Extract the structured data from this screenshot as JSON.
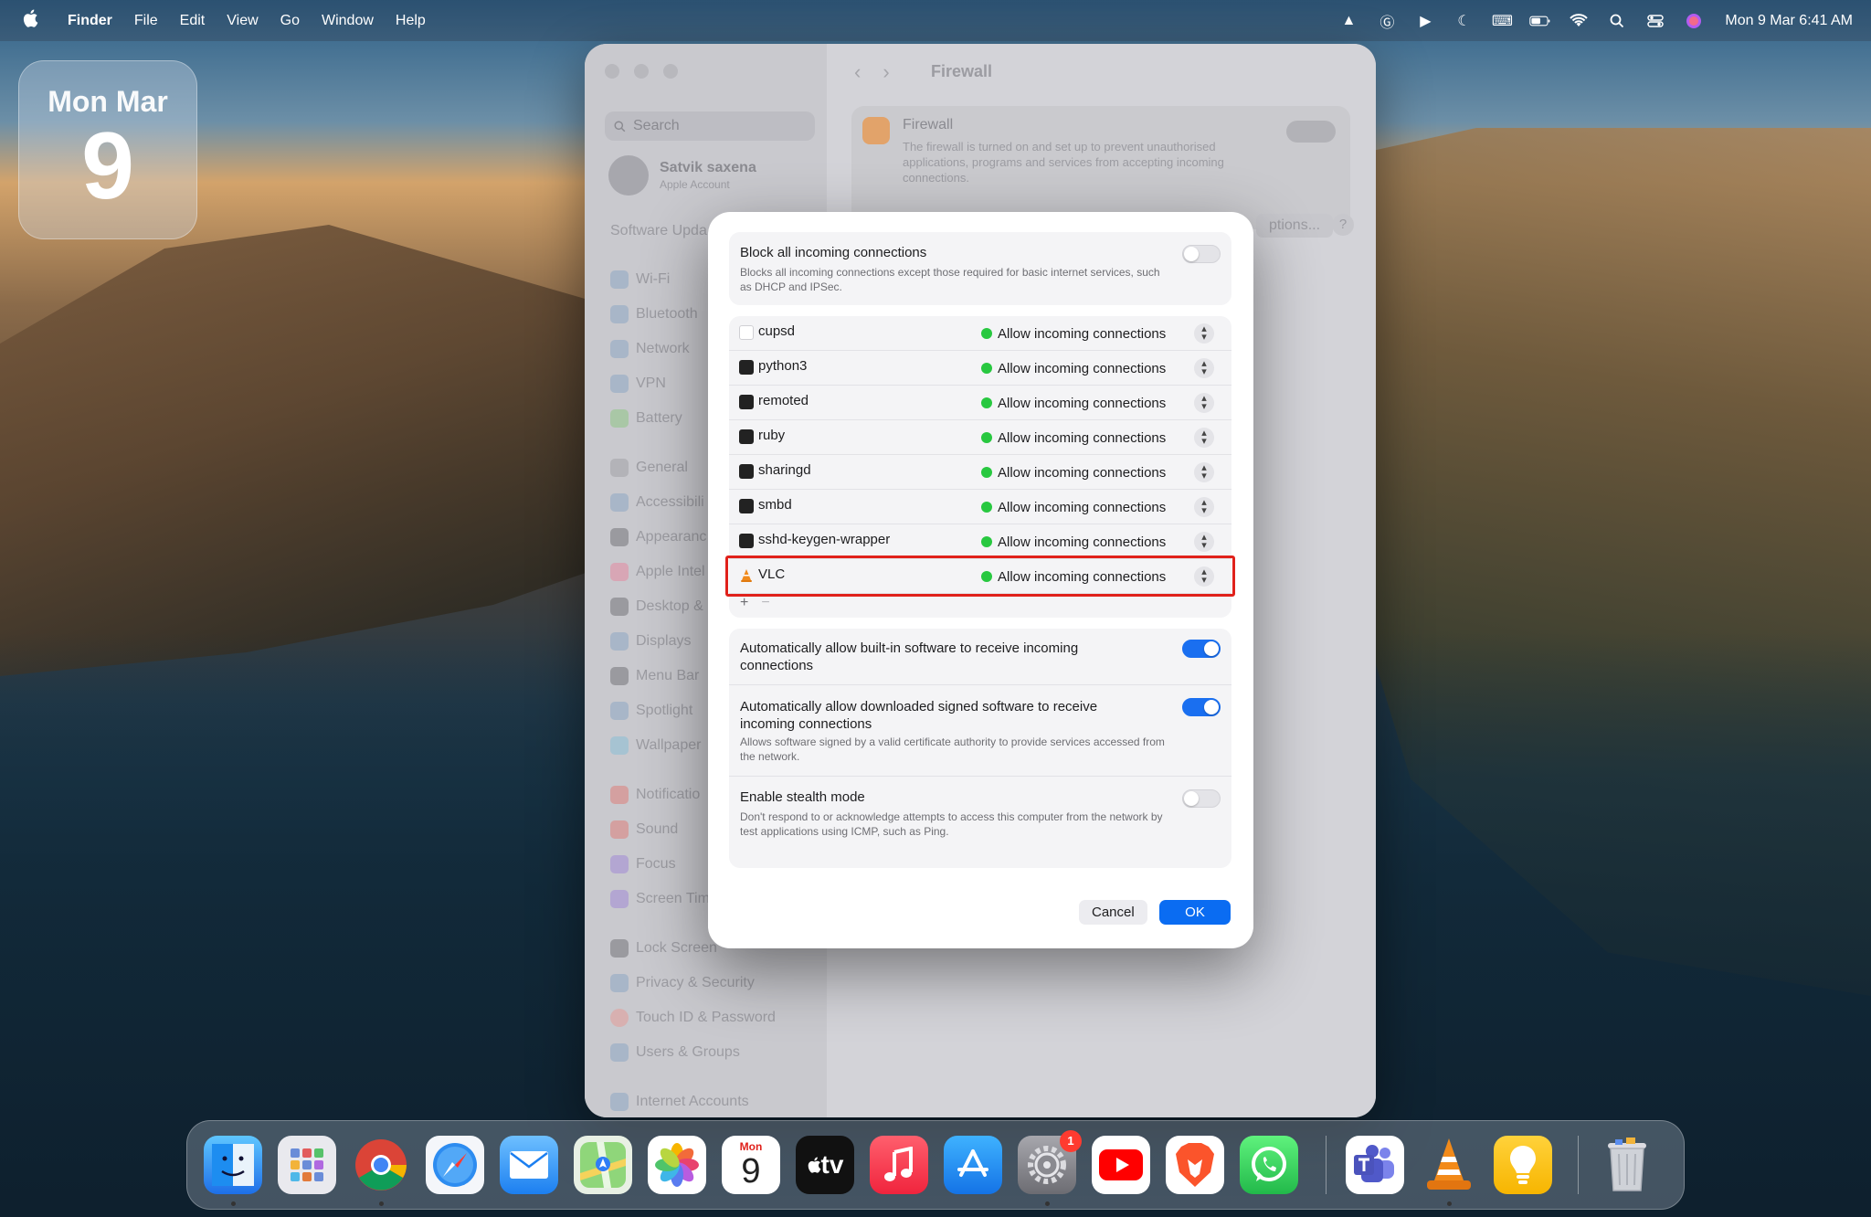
{
  "menubar": {
    "apple_icon": "apple-icon",
    "items": [
      "Finder",
      "File",
      "Edit",
      "View",
      "Go",
      "Window",
      "Help"
    ],
    "status_icons": [
      "vlc-icon",
      "grammarly-icon",
      "play-circle-icon",
      "moon-icon",
      "keyboard-icon",
      "battery-icon",
      "wifi-icon",
      "search-icon",
      "control-center-icon",
      "siri-icon"
    ],
    "clock": "Mon 9 Mar  6:41 AM"
  },
  "date_widget": {
    "month": "Mon Mar",
    "day": "9"
  },
  "settings_window": {
    "search_placeholder": "Search",
    "account_name": "Satvik saxena",
    "account_sub": "Apple Account",
    "software_update": "Software Upda",
    "sidebar_items": [
      "Wi-Fi",
      "Bluetooth",
      "Network",
      "VPN",
      "Battery",
      "General",
      "Accessibili",
      "Appearanc",
      "Apple Intel",
      "Desktop &",
      "Displays",
      "Menu Bar",
      "Spotlight",
      "Wallpaper",
      "Notificatio",
      "Sound",
      "Focus",
      "Screen Tim",
      "Lock Screen",
      "Privacy & Security",
      "Touch ID & Password",
      "Users & Groups",
      "Internet Accounts"
    ],
    "title": "Firewall",
    "firewall_card": {
      "title": "Firewall",
      "description": "The firewall is turned on and set up to prevent unauthorised applications, programs and services from accepting incoming connections."
    },
    "options_label": "ptions...",
    "help_label": "?"
  },
  "modal": {
    "block_all": {
      "title": "Block all incoming connections",
      "description": "Blocks all incoming connections except those required for basic internet services, such as DHCP and IPSec.",
      "on": false
    },
    "apps": [
      {
        "name": "cupsd",
        "status": "Allow incoming connections",
        "icon": "document-icon"
      },
      {
        "name": "python3",
        "status": "Allow incoming connections",
        "icon": "terminal-icon"
      },
      {
        "name": "remoted",
        "status": "Allow incoming connections",
        "icon": "terminal-icon"
      },
      {
        "name": "ruby",
        "status": "Allow incoming connections",
        "icon": "terminal-icon"
      },
      {
        "name": "sharingd",
        "status": "Allow incoming connections",
        "icon": "terminal-icon"
      },
      {
        "name": "smbd",
        "status": "Allow incoming connections",
        "icon": "terminal-icon"
      },
      {
        "name": "sshd-keygen-wrapper",
        "status": "Allow incoming connections",
        "icon": "terminal-icon"
      },
      {
        "name": "VLC",
        "status": "Allow incoming connections",
        "icon": "vlc-cone-icon"
      }
    ],
    "add_label": "+",
    "remove_label": "−",
    "auto_builtin": {
      "title": "Automatically allow built-in software to receive incoming connections",
      "on": true
    },
    "auto_signed": {
      "title": "Automatically allow downloaded signed software to receive incoming connections",
      "description": "Allows software signed by a valid certificate authority to provide services accessed from the network.",
      "on": true
    },
    "stealth": {
      "title": "Enable stealth mode",
      "description": "Don't respond to or acknowledge attempts to access this computer from the network by test applications using ICMP, such as Ping.",
      "on": false
    },
    "cancel_label": "Cancel",
    "ok_label": "OK"
  },
  "dock": {
    "apps": [
      "Finder",
      "Launchpad",
      "Google Chrome",
      "Safari",
      "Mail",
      "Maps",
      "Photos",
      "Calendar",
      "Apple TV",
      "Music",
      "App Store",
      "System Settings",
      "YouTube",
      "Brave",
      "WhatsApp",
      "Microsoft Teams",
      "VLC",
      "Tips",
      "Trash"
    ],
    "calendar_month": "Mon",
    "calendar_day": "9",
    "tv_label": "tv",
    "settings_badge": "1"
  },
  "colors": {
    "accent_blue": "#0a6cf2",
    "allow_green": "#28c840",
    "highlight_red": "#e0211b"
  }
}
